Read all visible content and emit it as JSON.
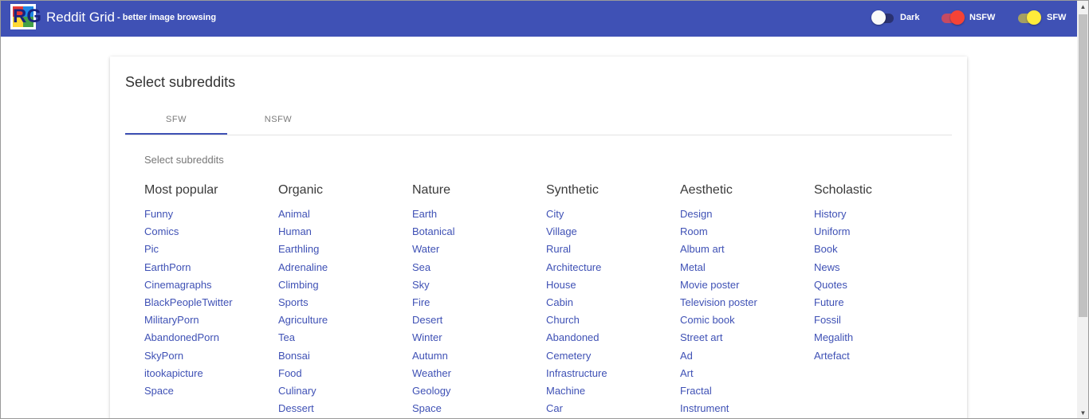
{
  "header": {
    "title": "Reddit Grid",
    "subtitle": "- better image browsing",
    "logo_letters": "RG",
    "toggles": [
      {
        "label": "Dark",
        "on": false
      },
      {
        "label": "NSFW",
        "on": true
      },
      {
        "label": "SFW",
        "on": true
      }
    ]
  },
  "card": {
    "title": "Select subreddits",
    "tabs": [
      {
        "label": "SFW",
        "active": true
      },
      {
        "label": "NSFW",
        "active": false
      }
    ],
    "section_label": "Select subreddits",
    "categories": [
      {
        "name": "Most popular",
        "items": [
          "Funny",
          "Comics",
          "Pic",
          "EarthPorn",
          "Cinemagraphs",
          "BlackPeopleTwitter",
          "MilitaryPorn",
          "AbandonedPorn",
          "SkyPorn",
          "itookapicture",
          "Space"
        ]
      },
      {
        "name": "Organic",
        "items": [
          "Animal",
          "Human",
          "Earthling",
          "Adrenaline",
          "Climbing",
          "Sports",
          "Agriculture",
          "Tea",
          "Bonsai",
          "Food",
          "Culinary",
          "Dessert"
        ]
      },
      {
        "name": "Nature",
        "items": [
          "Earth",
          "Botanical",
          "Water",
          "Sea",
          "Sky",
          "Fire",
          "Desert",
          "Winter",
          "Autumn",
          "Weather",
          "Geology",
          "Space"
        ]
      },
      {
        "name": "Synthetic",
        "items": [
          "City",
          "Village",
          "Rural",
          "Architecture",
          "House",
          "Cabin",
          "Church",
          "Abandoned",
          "Cemetery",
          "Infrastructure",
          "Machine",
          "Car"
        ]
      },
      {
        "name": "Aesthetic",
        "items": [
          "Design",
          "Room",
          "Album art",
          "Metal",
          "Movie poster",
          "Television poster",
          "Comic book",
          "Street art",
          "Ad",
          "Art",
          "Fractal",
          "Instrument"
        ]
      },
      {
        "name": "Scholastic",
        "items": [
          "History",
          "Uniform",
          "Book",
          "News",
          "Quotes",
          "Future",
          "Fossil",
          "Megalith",
          "Artefact"
        ]
      }
    ]
  },
  "colors": {
    "primary": "#3f51b5",
    "link": "#3f51b5",
    "nsfw_thumb": "#f44336",
    "sfw_thumb": "#ffeb3b"
  }
}
